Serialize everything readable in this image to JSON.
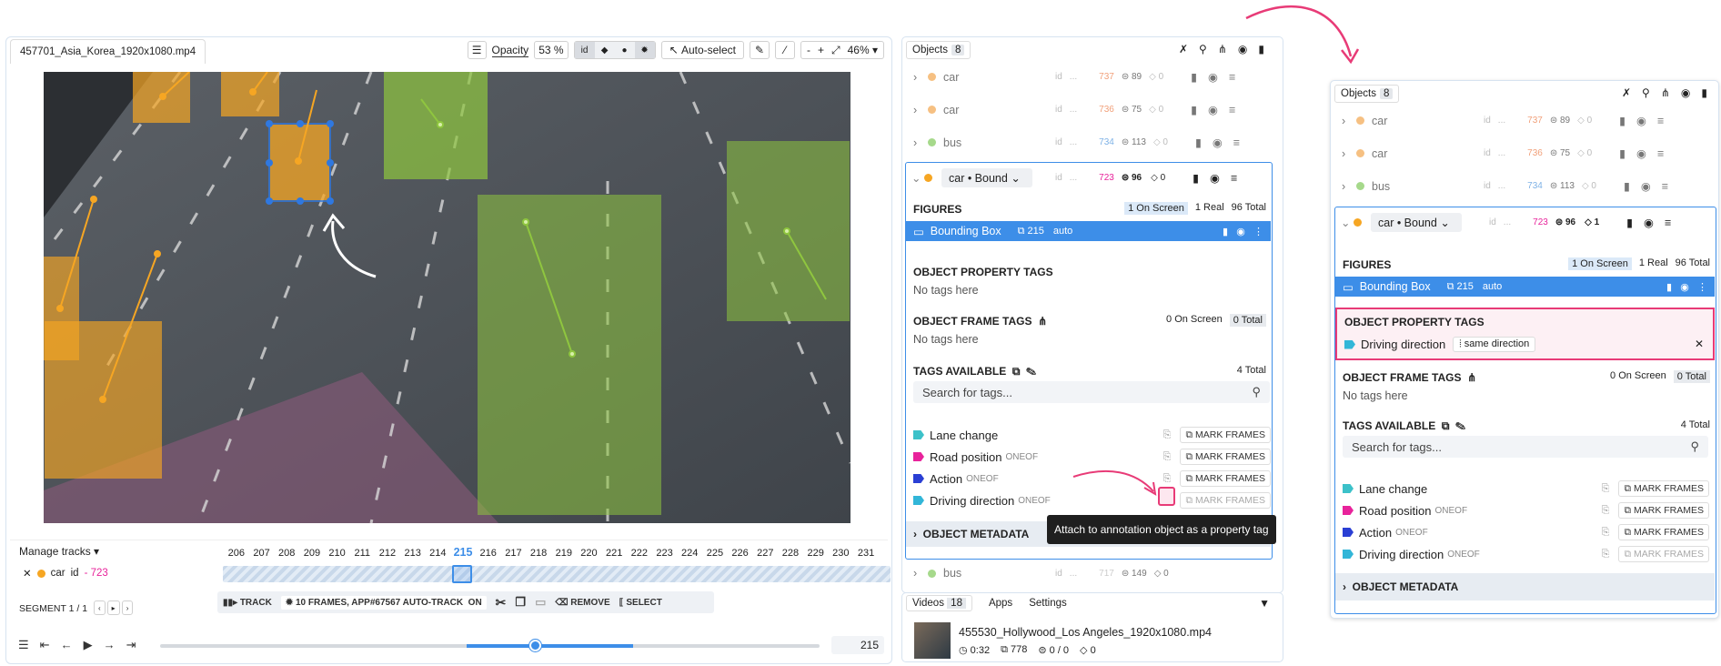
{
  "file_tab": "457701_Asia_Korea_1920x1080.mp4",
  "toolbar": {
    "opacity_label": "Opacity",
    "opacity_value": "53",
    "opacity_unit": "%",
    "id_label": "id",
    "autoselect_label": "Auto-select",
    "zoom_minus": "-",
    "zoom_plus": "+",
    "zoom_value": "46%"
  },
  "timeline": {
    "manage_tracks": "Manage tracks",
    "track_class": "car",
    "track_id_label": "id",
    "track_id": "- 723",
    "segment_label": "SEGMENT 1 / 1",
    "frames": [
      "206",
      "207",
      "208",
      "209",
      "210",
      "211",
      "212",
      "213",
      "214",
      "215",
      "216",
      "217",
      "218",
      "219",
      "220",
      "221",
      "222",
      "223",
      "224",
      "225",
      "226",
      "227",
      "228",
      "229",
      "230",
      "231"
    ],
    "current_frame": "215",
    "track_btn": "TRACK",
    "frames_info": "10 FRAMES, APP#67567 AUTO-TRACK",
    "on_label": "ON",
    "remove_btn": "REMOVE",
    "select_btn": "SELECT",
    "frame_input": "215",
    "progress": 0.5
  },
  "objects": {
    "tab_label": "Objects",
    "count": "8",
    "rows": [
      {
        "name": "car",
        "color": "#f6c082",
        "id_label": "id",
        "dots": "...",
        "num": "737",
        "num_color": "#f1a07a",
        "figs": "89",
        "tags": "0"
      },
      {
        "name": "car",
        "color": "#f6c082",
        "id_label": "id",
        "dots": "...",
        "num": "736",
        "num_color": "#f1a07a",
        "figs": "75",
        "tags": "0"
      },
      {
        "name": "bus",
        "color": "#a6d98b",
        "id_label": "id",
        "dots": "...",
        "num": "734",
        "num_color": "#7fb2e6",
        "figs": "113",
        "tags": "0"
      }
    ],
    "selected": {
      "label": "car • Bound",
      "id_label": "id",
      "dots": "...",
      "num": "723",
      "figs": "96",
      "tags_left": "0",
      "tags_right": "1"
    },
    "figures_label": "FIGURES",
    "on_screen": "1 On Screen",
    "real": "1 Real",
    "total": "96 Total",
    "bbox_label": "Bounding Box",
    "bbox_frames": "215",
    "bbox_auto": "auto",
    "prop_tags_label": "OBJECT PROPERTY TAGS",
    "no_tags": "No tags here",
    "frame_tags_label": "OBJECT FRAME TAGS",
    "frame_on_screen": "0 On Screen",
    "frame_total": "0 Total",
    "tags_available_label": "TAGS AVAILABLE",
    "tags_total": "4 Total",
    "search_placeholder": "Search for tags...",
    "tags": [
      {
        "name": "Lane change",
        "oneof": "",
        "color": "#3cc1c9"
      },
      {
        "name": "Road position",
        "oneof": "ONEOF",
        "color": "#e8239b"
      },
      {
        "name": "Action",
        "oneof": "ONEOF",
        "color": "#2a3fd4"
      },
      {
        "name": "Driving direction",
        "oneof": "ONEOF",
        "color": "#32b6d8"
      }
    ],
    "mark_frames": "MARK FRAMES",
    "metadata_label": "OBJECT METADATA",
    "tooltip": "Attach to annotation object as a property tag",
    "bus_row": {
      "name": "bus",
      "id_label": "id",
      "dots": "...",
      "num": "717",
      "figs": "149",
      "tags": "0"
    },
    "driving_tag": "Driving direction",
    "driving_value": "same direction"
  },
  "videos": {
    "tab_label": "Videos",
    "count": "18",
    "apps_tab": "Apps",
    "settings_tab": "Settings",
    "item_name": "455530_Hollywood_Los Angeles_1920x1080.mp4",
    "duration": "0:32",
    "frames": "778",
    "objects": "0 / 0",
    "tags": "0"
  },
  "colors": {
    "accent": "#3d8ee8",
    "highlight": "#e83b77",
    "car": "#f6a623",
    "bus": "#8fc63f"
  }
}
